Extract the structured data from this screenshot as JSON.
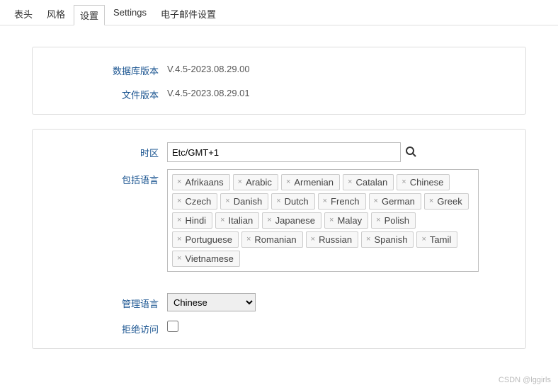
{
  "tabs": {
    "items": [
      {
        "label": "表头",
        "active": false
      },
      {
        "label": "风格",
        "active": false
      },
      {
        "label": "设置",
        "active": true
      },
      {
        "label": "Settings",
        "active": false
      },
      {
        "label": "电子邮件设置",
        "active": false
      }
    ]
  },
  "versions": {
    "db_label": "数据库版本",
    "db_value": "V.4.5-2023.08.29.00",
    "file_label": "文件版本",
    "file_value": "V.4.5-2023.08.29.01"
  },
  "settings": {
    "timezone_label": "时区",
    "timezone_value": "Etc/GMT+1",
    "include_langs_label": "包括语言",
    "langs": [
      "Afrikaans",
      "Arabic",
      "Armenian",
      "Catalan",
      "Chinese",
      "Czech",
      "Danish",
      "Dutch",
      "French",
      "German",
      "Greek",
      "Hindi",
      "Italian",
      "Japanese",
      "Malay",
      "Polish",
      "Portuguese",
      "Romanian",
      "Russian",
      "Spanish",
      "Tamil",
      "Vietnamese"
    ],
    "admin_lang_label": "管理语言",
    "admin_lang_value": "Chinese",
    "deny_access_label": "拒绝访问",
    "deny_access_checked": false
  },
  "watermark": "CSDN @lggirls"
}
